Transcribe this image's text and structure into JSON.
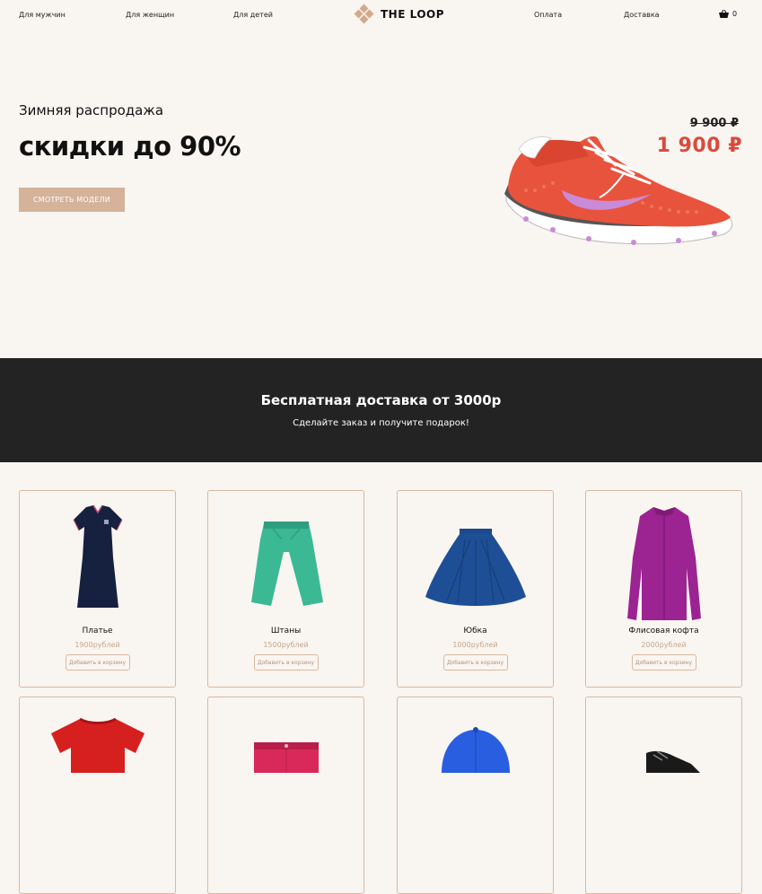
{
  "nav": {
    "links": [
      "Для мужчин",
      "Для женщин",
      "Для детей",
      "Оплата",
      "Доставка"
    ],
    "logo_text": "THE LOOP",
    "cart_count": "0"
  },
  "hero": {
    "subtitle": "Зимняя распродажа",
    "headline": "скидки до 90%",
    "button": "СМОТРЕТЬ МОДЕЛИ",
    "old_price": "9 900 ₽",
    "new_price": "1 900 ₽"
  },
  "promo": {
    "title": "Бесплатная доставка от 3000р",
    "text": "Сделайте заказ и получите подарок!"
  },
  "products": [
    {
      "name": "Платье",
      "price": "1900рублей",
      "button": "Добавить в корзину"
    },
    {
      "name": "Штаны",
      "price": "1500рублей",
      "button": "Добавить в корзину"
    },
    {
      "name": "Юбка",
      "price": "1000рублей",
      "button": "Добавить в корзину"
    },
    {
      "name": "Флисовая кофта",
      "price": "2000рублей",
      "button": "Добавить в корзину"
    }
  ],
  "colors": {
    "accent": "#d4b39a",
    "price_red": "#d94a3a",
    "band": "#232323",
    "background": "#f9f5f1"
  }
}
